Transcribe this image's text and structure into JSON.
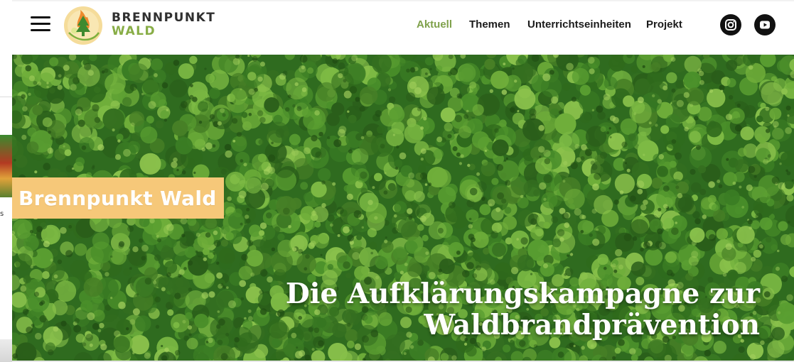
{
  "header": {
    "logo": {
      "line1": "BRENNPUNKT",
      "line2": "WALD",
      "emblem_icon": "tree-flame-emblem-icon"
    },
    "menu_icon": "hamburger-menu-icon",
    "nav": [
      {
        "label": "Aktuell",
        "active": true
      },
      {
        "label": "Themen",
        "active": false
      },
      {
        "label": "Unterrichtseinheiten",
        "active": false
      },
      {
        "label": "Projekt",
        "active": false
      }
    ],
    "social": [
      {
        "icon": "instagram-icon"
      },
      {
        "icon": "youtube-icon"
      }
    ]
  },
  "hero": {
    "badge_text": "Brennpunkt Wald",
    "tagline_line1": "Die Aufklärungskampagne zur",
    "tagline_line2": "Waldbrandprävention",
    "image_icon": "forest-canopy-aerial-image"
  },
  "background_page": {
    "partial_text": "s"
  },
  "colors": {
    "accent_green": "#7fa14b",
    "logo_green": "#88ad46",
    "badge_orange": "#f6c879",
    "text_dark": "#1b1b1b"
  }
}
